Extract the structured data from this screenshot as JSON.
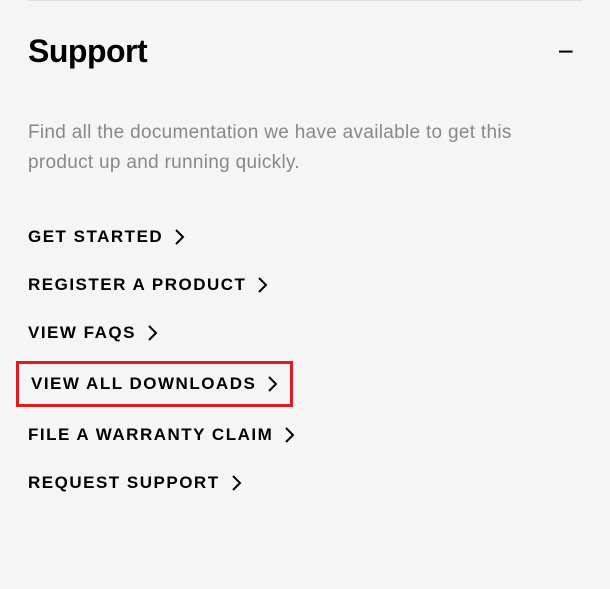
{
  "section": {
    "title": "Support",
    "collapse_symbol": "−",
    "description": "Find all the documentation we have available to get this product up and running quickly.",
    "links": [
      {
        "label": "GET STARTED"
      },
      {
        "label": "REGISTER A PRODUCT"
      },
      {
        "label": "VIEW FAQS"
      },
      {
        "label": "VIEW ALL DOWNLOADS",
        "highlighted": true
      },
      {
        "label": "FILE A WARRANTY CLAIM"
      },
      {
        "label": "REQUEST SUPPORT"
      }
    ]
  }
}
